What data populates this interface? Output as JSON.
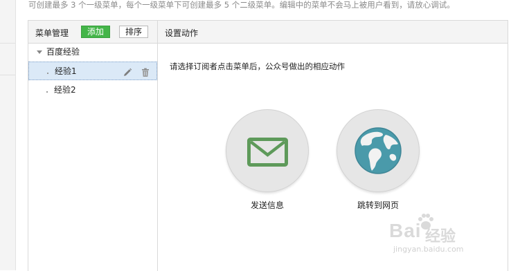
{
  "notice": "可创建最多 3 个一级菜单，每个一级菜单下可创建最多 5 个二级菜单。编辑中的菜单不会马上被用户看到，请放心调试。",
  "menu_panel": {
    "title": "菜单管理",
    "add_label": "添加",
    "sort_label": "排序",
    "tree": {
      "parent": "百度经验",
      "children": [
        "经验1",
        "经验2"
      ]
    }
  },
  "action_panel": {
    "title": "设置动作",
    "prompt": "请选择订阅者点击菜单后，公众号做出的相应动作",
    "options": [
      {
        "label": "发送信息",
        "icon": "envelope-icon"
      },
      {
        "label": "跳转到网页",
        "icon": "globe-icon"
      }
    ]
  },
  "watermark": {
    "brand": "Bai",
    "text": "经验",
    "url": "jingyan.baidu.com"
  },
  "colors": {
    "accent_green": "#44b549",
    "envelope_green": "#5e9a5a",
    "globe_teal": "#4a9aaa",
    "selected_row": "#dbe9f7"
  }
}
